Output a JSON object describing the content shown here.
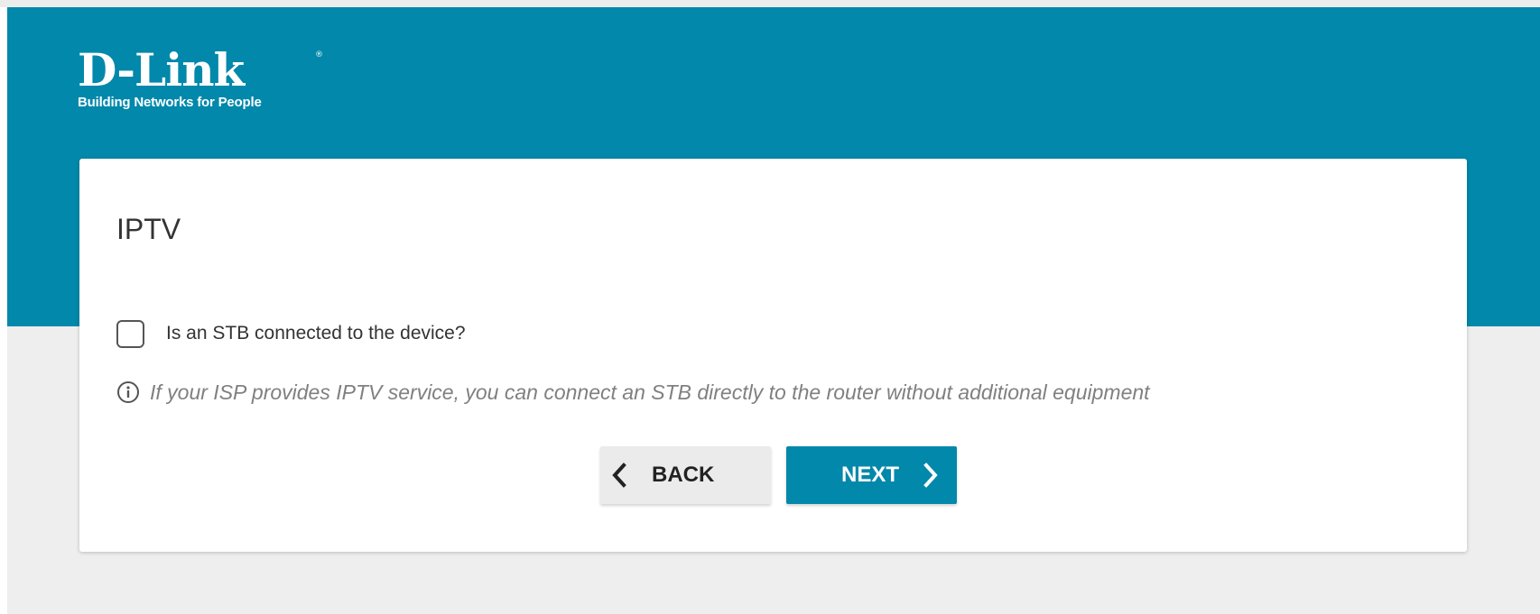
{
  "header": {
    "logo_text": "D-Link",
    "logo_registered": "®",
    "logo_tagline": "Building Networks for People"
  },
  "wizard": {
    "title": "IPTV",
    "stb_checkbox": {
      "label": "Is an STB connected to the device?",
      "checked": false
    },
    "hint": "If your ISP provides IPTV service, you can connect an STB directly to the router without additional equipment",
    "back_label": "BACK",
    "next_label": "NEXT"
  },
  "colors": {
    "brand": "#0188ab",
    "page_background": "#eeeeee",
    "card_background": "#ffffff",
    "back_button": "#ebebeb"
  },
  "icons": {
    "hint": "info-icon",
    "back": "chevron-left-icon",
    "next": "chevron-right-icon"
  }
}
